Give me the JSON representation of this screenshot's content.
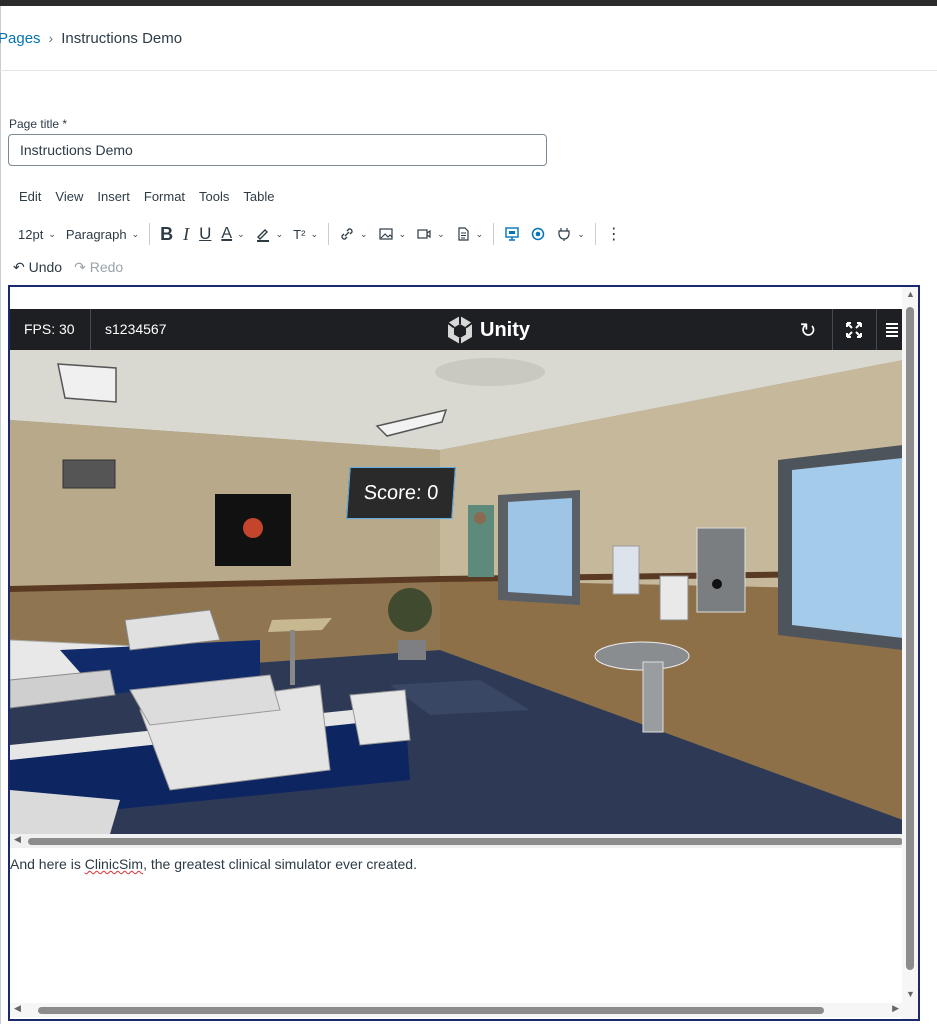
{
  "breadcrumb": {
    "parent": "Pages",
    "current": "Instructions Demo"
  },
  "title_field": {
    "label": "Page title *",
    "value": "Instructions Demo"
  },
  "menubar": [
    "Edit",
    "View",
    "Insert",
    "Format",
    "Tools",
    "Table"
  ],
  "toolbar": {
    "font_size": "12pt",
    "block_format": "Paragraph",
    "bold": "B",
    "italic": "I",
    "underline": "U",
    "text_color": "A",
    "superscript": "T²"
  },
  "history": {
    "undo": "Undo",
    "redo": "Redo"
  },
  "unity": {
    "fps": "FPS: 30",
    "student_id": "s1234567",
    "brand": "Unity",
    "score": "Score: 0"
  },
  "content": {
    "text_before": "And here is ",
    "misspelled": "ClinicSim",
    "text_after": ", the greatest clinical simulator ever created."
  },
  "icons": [
    "undo-icon",
    "redo-icon",
    "link-icon",
    "image-icon",
    "media-icon",
    "document-icon",
    "embed-icon",
    "record-icon",
    "plugin-icon",
    "more-icon",
    "unity-logo-icon",
    "reload-icon",
    "fullscreen-icon",
    "menu-icon"
  ],
  "colors": {
    "link": "#0374b5",
    "editor_border": "#1a2a6c",
    "unity_bar": "#1e1f22",
    "score_border": "#5db0e8"
  }
}
